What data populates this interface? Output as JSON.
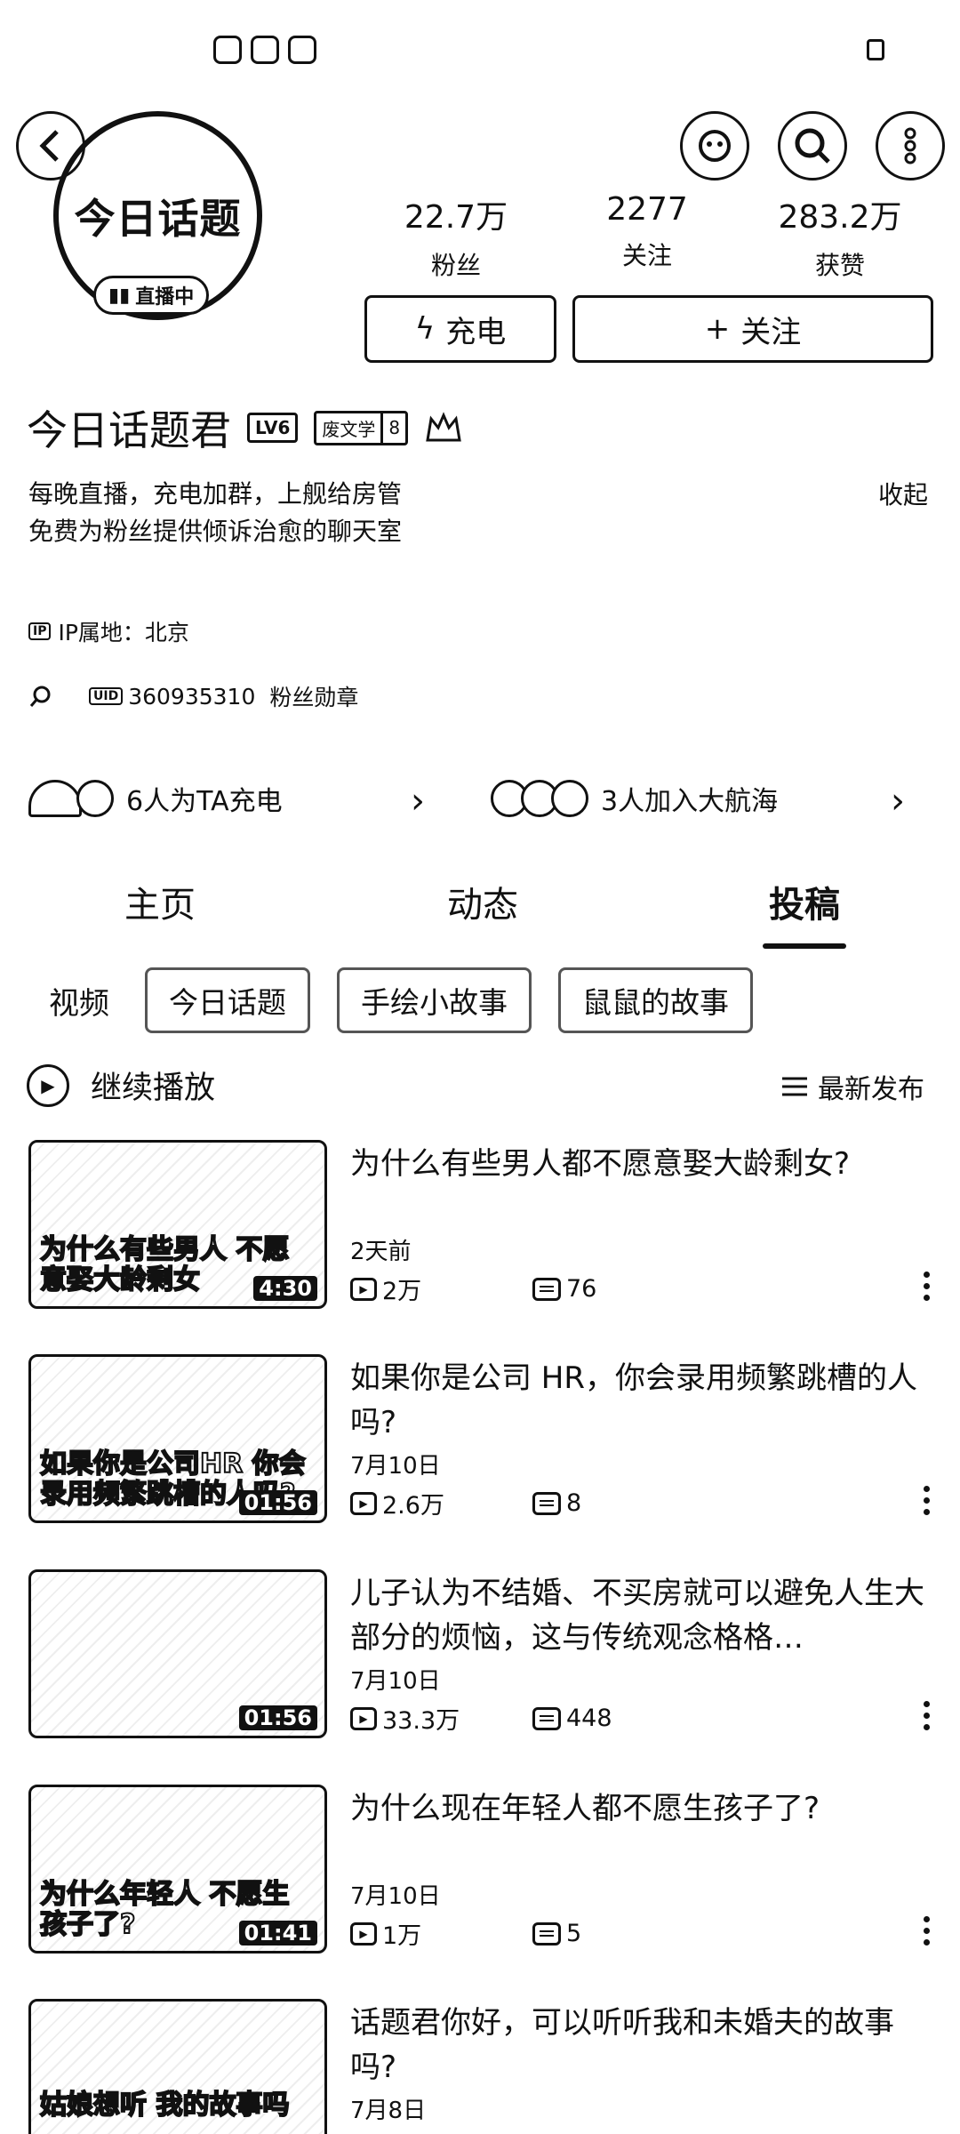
{
  "header": {
    "avatar_text": "今日话题",
    "live_badge": "直播中"
  },
  "stats": [
    {
      "value": "22.7万",
      "label": "粉丝"
    },
    {
      "value": "2277",
      "label": "关注"
    },
    {
      "value": "283.2万",
      "label": "获赞"
    }
  ],
  "actions": {
    "charge_label": "充电",
    "follow_label": "关注"
  },
  "profile": {
    "name": "今日话题君",
    "level": "LV6",
    "medal_name": "废文学",
    "medal_level": "8",
    "bio_line1": "每晚直播，充电加群，上舰给房管",
    "bio_line2": "免费为粉丝提供倾诉治愈的聊天室",
    "collapse_label": "收起",
    "ip_tag": "IP",
    "ip_label": "IP属地：北京",
    "uid_tag": "UID",
    "uid": "360935310",
    "fan_medal_label": "粉丝勋章"
  },
  "support": {
    "charge_text": "6人为TA充电",
    "fleet_text": "3人加入大航海"
  },
  "tabs": [
    {
      "label": "主页"
    },
    {
      "label": "动态"
    },
    {
      "label": "投稿"
    }
  ],
  "filters": {
    "label": "视频",
    "chips": [
      "今日话题",
      "手绘小故事",
      "鼠鼠的故事"
    ]
  },
  "list_controls": {
    "continue_label": "继续播放",
    "sort_label": "最新发布"
  },
  "videos": [
    {
      "title": "为什么有些男人都不愿意娶大龄剩女?",
      "date": "2天前",
      "views": "2万",
      "comments": "76",
      "caption": "为什么有些男人 不愿意娶大龄剩女",
      "duration": "4:30"
    },
    {
      "title": "如果你是公司 HR，你会录用频繁跳槽的人吗?",
      "date": "7月10日",
      "views": "2.6万",
      "comments": "8",
      "caption": "如果你是公司HR 你会录用频繁跳槽的人吗?",
      "duration": "01:56"
    },
    {
      "title": "儿子认为不结婚、不买房就可以避免人生大部分的烦恼，这与传统观念格格…",
      "date": "7月10日",
      "views": "33.3万",
      "comments": "448",
      "caption": "",
      "duration": "01:56"
    },
    {
      "title": "为什么现在年轻人都不愿生孩子了?",
      "date": "7月10日",
      "views": "1万",
      "comments": "5",
      "caption": "为什么年轻人 不愿生孩子了?",
      "duration": "01:41"
    },
    {
      "title": "话题君你好，可以听听我和未婚夫的故事吗?",
      "date": "7月8日",
      "views": "",
      "comments": "",
      "caption": "姑娘想听 我的故事吗",
      "duration": ""
    }
  ]
}
